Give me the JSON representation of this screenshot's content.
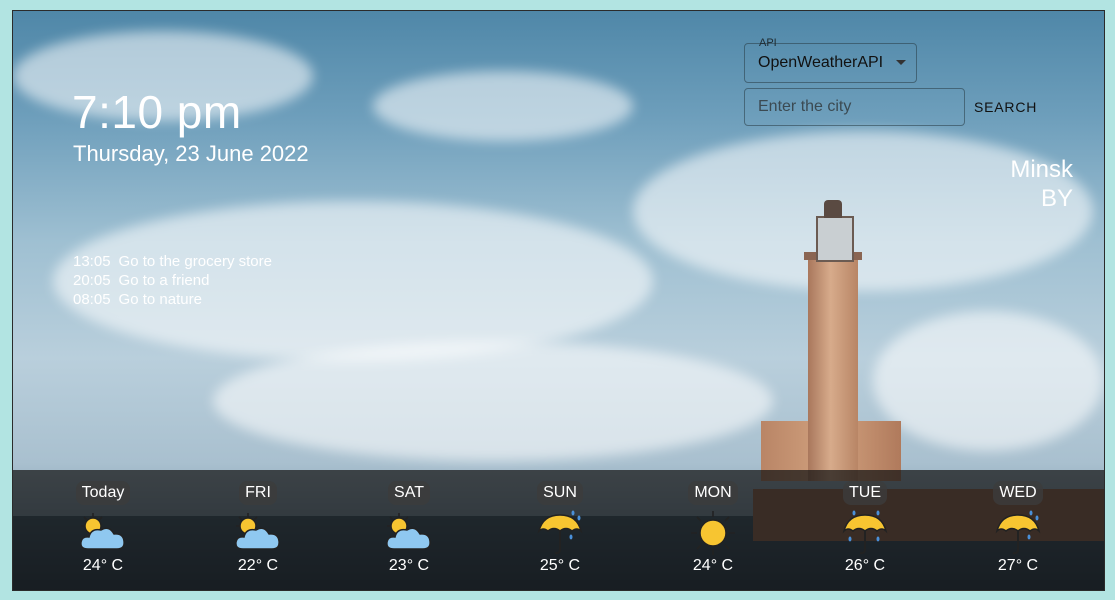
{
  "clock": {
    "time": "7:10 pm",
    "date": "Thursday, 23 June 2022"
  },
  "todos": [
    {
      "time": "13:05",
      "text": "Go to the grocery store"
    },
    {
      "time": "20:05",
      "text": "Go to a friend"
    },
    {
      "time": "08:05",
      "text": "Go to nature"
    }
  ],
  "api": {
    "label": "API",
    "selected": "OpenWeatherAPI"
  },
  "search": {
    "placeholder": "Enter the city",
    "button_label": "SEARCH"
  },
  "location": {
    "city": "Minsk",
    "country": "BY"
  },
  "forecast": [
    {
      "day": "Today",
      "icon": "partly-cloudy-icon",
      "temp": "24° C"
    },
    {
      "day": "FRI",
      "icon": "partly-cloudy-icon",
      "temp": "22° C"
    },
    {
      "day": "SAT",
      "icon": "partly-cloudy-icon",
      "temp": "23° C"
    },
    {
      "day": "SUN",
      "icon": "umbrella-rain-icon",
      "temp": "25° C"
    },
    {
      "day": "MON",
      "icon": "sun-icon",
      "temp": "24° C"
    },
    {
      "day": "TUE",
      "icon": "umbrella-rain-icon",
      "temp": "26° C"
    },
    {
      "day": "WED",
      "icon": "umbrella-rain-icon",
      "temp": "27° C"
    }
  ],
  "colors": {
    "page_border": "#b2e4e2",
    "forecast_bar": "#141414",
    "sun": "#f7c531",
    "cloud": "#8fc8f0"
  }
}
